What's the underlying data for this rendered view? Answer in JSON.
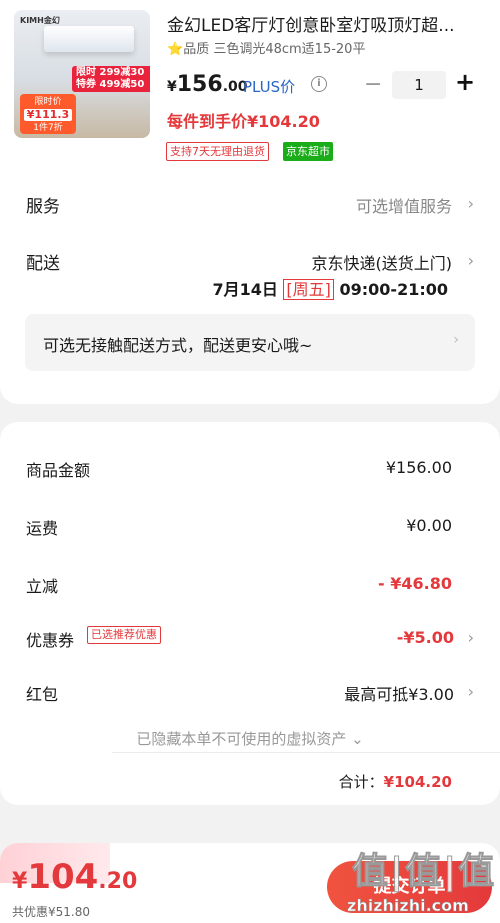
{
  "product": {
    "title": "金幻LED客厅灯创意卧室灯吸顶灯超...",
    "star": "⭐",
    "subtitle": "品质 三色调光48cm适15-20平",
    "price_symbol": "¥",
    "price_main": "156",
    "price_decimal": ".00",
    "plus_label": "PLUS价",
    "quantity": "1",
    "hand_price": "每件到手价¥104.20",
    "badge_return": "支持7天无理由退货",
    "badge_store": "京东超市",
    "thumb_brand": "KIMH金幻",
    "thumb_promo_line1": "限时 299减30",
    "thumb_promo_line2": "特券 499减50",
    "thumb_tag_line1": "限时价",
    "thumb_tag_price": "¥111.3",
    "thumb_tag_line2": "1件7折"
  },
  "service": {
    "label": "服务",
    "value": "可选增值服务"
  },
  "delivery": {
    "label": "配送",
    "value": "京东快递(送货上门)",
    "date": "7月14日",
    "weekday": "[周五]",
    "time": "09:00-21:00",
    "contactless": "可选无接触配送方式，配送更安心哦~"
  },
  "summary": {
    "goods_label": "商品金额",
    "goods_value": "¥156.00",
    "freight_label": "运费",
    "freight_value": "¥0.00",
    "discount_label": "立减",
    "discount_value": "- ¥46.80",
    "coupon_label": "优惠券",
    "coupon_tag": "已选推荐优惠",
    "coupon_value": "-¥5.00",
    "redpacket_label": "红包",
    "redpacket_value": "最高可抵¥3.00",
    "hidden_assets": "已隐藏本单不可使用的虚拟资产 ⌄",
    "total_label": "合计：",
    "total_value": "¥104.20"
  },
  "bottom_bar": {
    "price_symbol": "¥",
    "price_int": "104",
    "price_dec": ".20",
    "saved": "共优惠¥51.80",
    "submit": "提交订单",
    "watermark_cn": "值|值|值",
    "watermark_en": "zhizhizhi.com"
  },
  "colors": {
    "accent_red": "#e4393c",
    "plus_blue": "#2a66c4",
    "store_green": "#1aad19"
  }
}
